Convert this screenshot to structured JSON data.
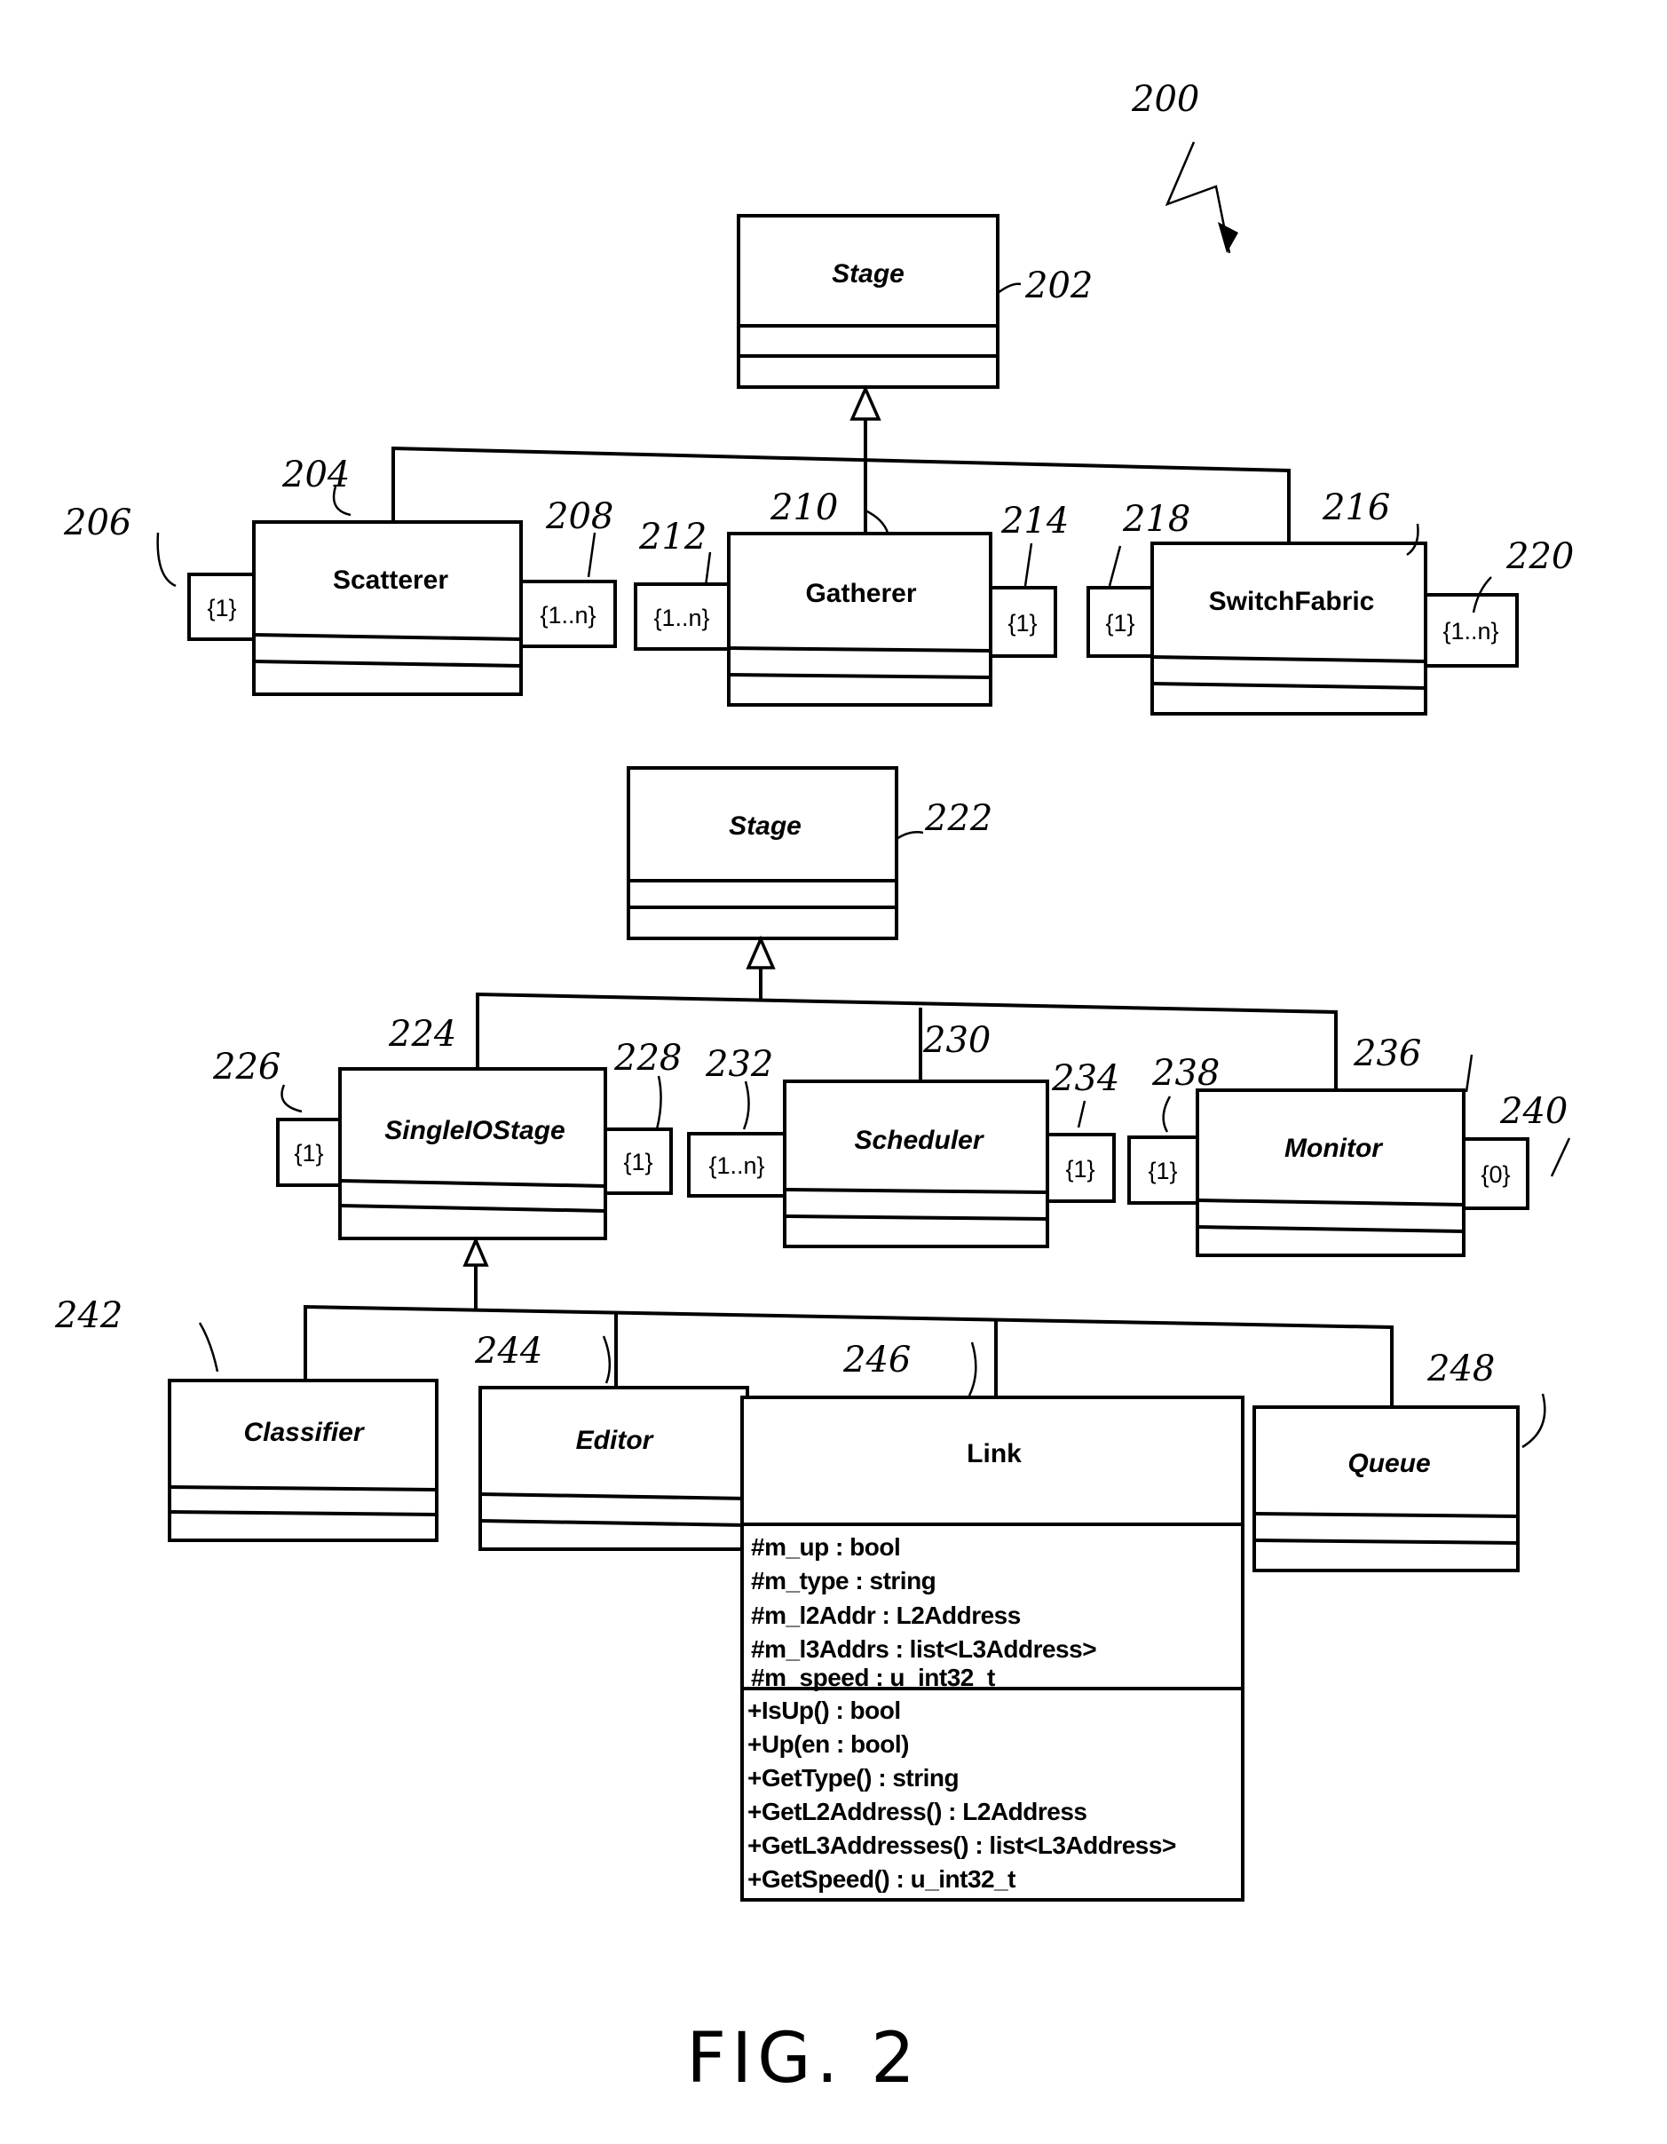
{
  "figure": {
    "label": "FIG. 2",
    "ref": "200"
  },
  "top_diagram": {
    "parent": {
      "name": "Stage",
      "ref": "202",
      "italic": true
    },
    "children": [
      {
        "name": "Scatterer",
        "ref": "204",
        "italic": false,
        "left_mult": "{1}",
        "left_ref": "206",
        "right_mult": "{1..n}",
        "right_ref": "208"
      },
      {
        "name": "Gatherer",
        "ref": "210",
        "italic": false,
        "left_mult": "{1..n}",
        "left_ref": "212",
        "right_mult": "{1}",
        "right_ref": "214"
      },
      {
        "name": "SwitchFabric",
        "ref": "216",
        "italic": false,
        "left_mult": "{1}",
        "left_ref": "218",
        "right_mult": "{1..n}",
        "right_ref": "220"
      }
    ]
  },
  "middle_diagram": {
    "parent": {
      "name": "Stage",
      "ref": "222",
      "italic": true
    },
    "children": [
      {
        "name": "SingleIOStage",
        "ref": "224",
        "italic": true,
        "left_mult": "{1}",
        "left_ref": "226",
        "right_mult": "{1}",
        "right_ref": "228"
      },
      {
        "name": "Scheduler",
        "ref": "230",
        "italic": true,
        "left_mult": "{1..n}",
        "left_ref": "232",
        "right_mult": "{1}",
        "right_ref": "234"
      },
      {
        "name": "Monitor",
        "ref": "236",
        "italic": true,
        "left_mult": "{1}",
        "left_ref": "238",
        "right_mult": "{0}",
        "right_ref": "240"
      }
    ]
  },
  "bottom_diagram": {
    "parent_name": "SingleIOStage",
    "children": [
      {
        "name": "Classifier",
        "ref": "242",
        "italic": true
      },
      {
        "name": "Editor",
        "ref": "244",
        "italic": true
      },
      {
        "name": "Link",
        "ref": "246",
        "italic": false,
        "attributes": [
          "#m_up : bool",
          "#m_type : string",
          "#m_l2Addr : L2Address",
          "#m_l3Addrs : list<L3Address>",
          "#m_speed : u_int32_t"
        ],
        "operations": [
          "+IsUp() : bool",
          "+Up(en : bool)",
          "+GetType() : string",
          "+GetL2Address() : L2Address",
          "+GetL3Addresses() : list<L3Address>",
          "+GetSpeed() : u_int32_t"
        ]
      },
      {
        "name": "Queue",
        "ref": "248",
        "italic": true
      }
    ]
  }
}
